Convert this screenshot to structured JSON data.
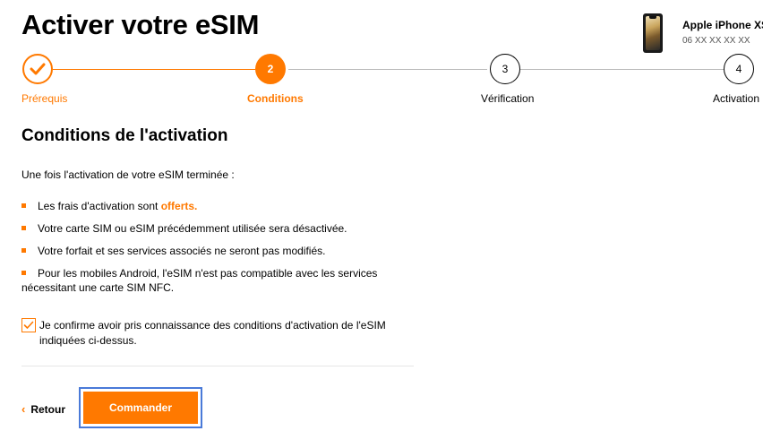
{
  "header": {
    "title": "Activer votre eSIM",
    "device": {
      "name": "Apple iPhone XS",
      "number": "06 XX XX XX XX",
      "image_icon": "phone-image"
    }
  },
  "stepper": {
    "accent_color": "#ff7900",
    "steps": [
      {
        "label": "Prérequis",
        "marker": "✓",
        "state": "completed"
      },
      {
        "label": "Conditions",
        "marker": "2",
        "state": "current"
      },
      {
        "label": "Vérification",
        "marker": "3",
        "state": "upcoming"
      },
      {
        "label": "Activation",
        "marker": "4",
        "state": "upcoming"
      }
    ]
  },
  "main": {
    "section_title": "Conditions de l'activation",
    "intro": "Une fois l'activation de votre eSIM terminée :",
    "conditions": [
      {
        "text": "Les frais d'activation sont ",
        "highlight": "offerts."
      },
      {
        "text": "Votre carte SIM ou eSIM précédemment utilisée sera désactivée.",
        "highlight": ""
      },
      {
        "text": "Votre forfait et ses services associés ne seront pas modifiés.",
        "highlight": ""
      },
      {
        "text": "Pour les mobiles Android, l'eSIM n'est pas compatible avec les services nécessitant une carte SIM NFC.",
        "highlight": ""
      }
    ],
    "confirm": {
      "checked": true,
      "text": "Je confirme avoir pris connaissance des conditions d'activation de l'eSIM indiquées ci-dessus."
    }
  },
  "actions": {
    "back_label": "Retour",
    "back_icon": "chevron-left-icon",
    "submit_label": "Commander"
  }
}
